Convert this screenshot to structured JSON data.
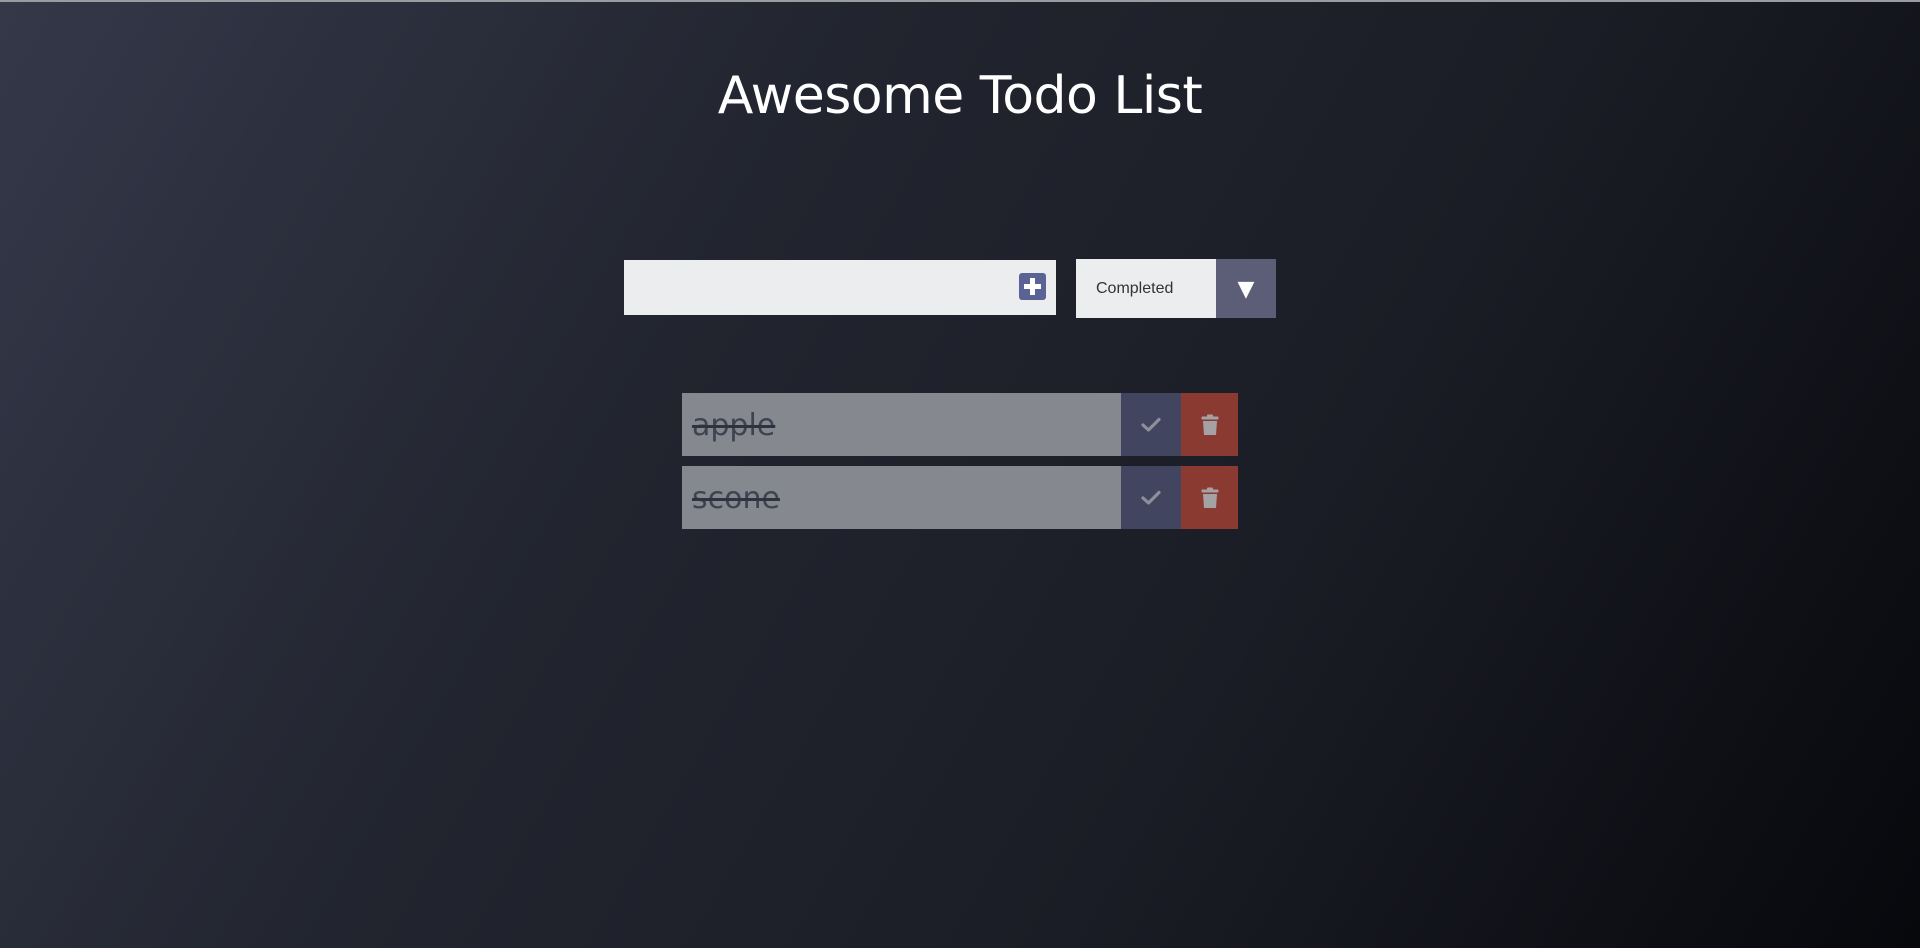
{
  "app": {
    "title": "Awesome Todo List"
  },
  "input": {
    "value": "",
    "placeholder": ""
  },
  "add_button": {
    "icon": "plus-square-icon"
  },
  "filter": {
    "selected": "Completed",
    "arrow": "▼"
  },
  "todos": [
    {
      "text": "apple",
      "completed": true
    },
    {
      "text": "scone",
      "completed": true
    }
  ],
  "colors": {
    "accent": "#5b6294",
    "complete_button": "#42455f",
    "trash_button": "#8a3a31",
    "item_background": "#85888f",
    "filter_arrow_bg": "#5b5e76"
  }
}
